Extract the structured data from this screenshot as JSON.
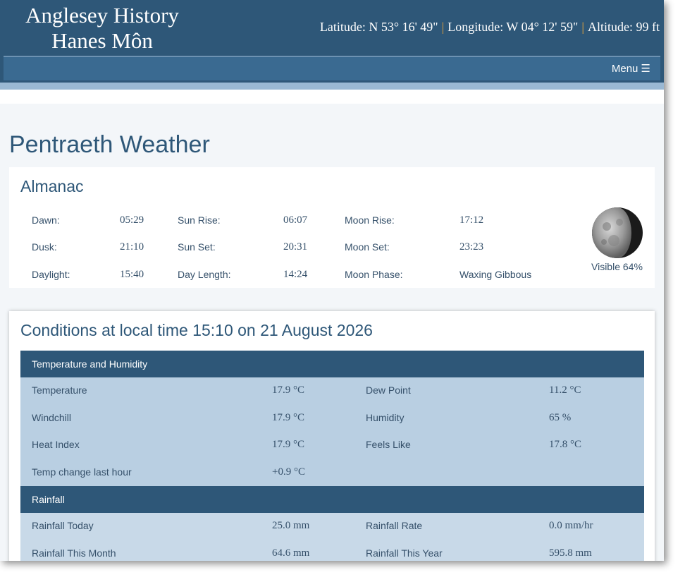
{
  "header": {
    "site_title_line1": "Anglesey History",
    "site_title_line2": "Hanes Môn",
    "latitude": "Latitude: N 53° 16' 49\"",
    "longitude": "Longitude: W 04° 12' 59\"",
    "altitude": "Altitude: 99 ft",
    "separator": "|",
    "menu_label": "Menu ☰"
  },
  "page_title": "Pentraeth Weather",
  "almanac": {
    "heading": "Almanac",
    "rows": [
      [
        {
          "label": "Dawn:",
          "value": "05:29"
        },
        {
          "label": "Sun Rise:",
          "value": "06:07"
        },
        {
          "label": "Moon Rise:",
          "value": "17:12"
        }
      ],
      [
        {
          "label": "Dusk:",
          "value": "21:10"
        },
        {
          "label": "Sun Set:",
          "value": "20:31"
        },
        {
          "label": "Moon Set:",
          "value": "23:23"
        }
      ],
      [
        {
          "label": "Daylight:",
          "value": "15:40"
        },
        {
          "label": "Day Length:",
          "value": "14:24"
        },
        {
          "label": "Moon Phase:",
          "value": "Waxing Gibbous"
        }
      ]
    ],
    "moon_visible": "Visible 64%",
    "moon_icon": "moon-phase-icon"
  },
  "conditions": {
    "heading": "Conditions at local time 15:10 on 21 August 2026",
    "sections": [
      {
        "title": "Temperature and Humidity",
        "rows": [
          [
            "Temperature",
            "17.9 °C",
            "Dew Point",
            "11.2 °C"
          ],
          [
            "Windchill",
            "17.9 °C",
            "Humidity",
            "65 %"
          ],
          [
            "Heat Index",
            "17.9 °C",
            "Feels Like",
            "17.8 °C"
          ],
          [
            "Temp change last hour",
            "+0.9 °C",
            "",
            ""
          ]
        ]
      },
      {
        "title": "Rainfall",
        "rows": [
          [
            "Rainfall Today",
            "25.0 mm",
            "Rainfall Rate",
            "0.0 mm/hr"
          ],
          [
            "Rainfall This Month",
            "64.6 mm",
            "Rainfall This Year",
            "595.8 mm"
          ]
        ]
      }
    ]
  },
  "colors": {
    "header_bg": "#2e5778",
    "nav_bg": "#3a6a91",
    "accent_separator": "#e6a33a",
    "row_bg": "#b9cfe2",
    "row_alt_bg": "#c8d9e8"
  }
}
